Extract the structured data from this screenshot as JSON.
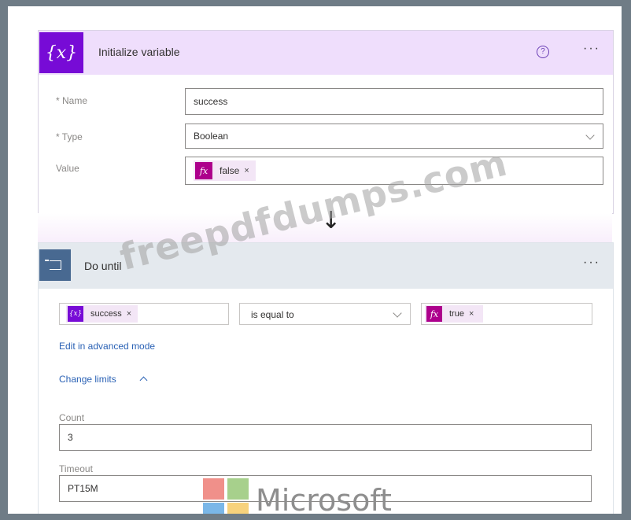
{
  "init_variable": {
    "title": "Initialize variable",
    "name_label": "* Name",
    "name_value": "success",
    "type_label": "* Type",
    "type_value": "Boolean",
    "value_label": "Value",
    "value_token": {
      "label": "false",
      "icon": "fx-icon"
    }
  },
  "do_until": {
    "title": "Do until",
    "condition": {
      "left_token": {
        "label": "success",
        "icon": "variable-icon"
      },
      "operator": "is equal to",
      "right_token": {
        "label": "true",
        "icon": "fx-icon"
      }
    },
    "advanced_link": "Edit in advanced mode",
    "change_limits_link": "Change limits",
    "count_label": "Count",
    "count_value": "3",
    "timeout_label": "Timeout",
    "timeout_value": "PT15M"
  },
  "watermark": "freepdfdumps.com",
  "brand": {
    "text": "Microsoft"
  },
  "glyphs": {
    "close": "×",
    "more": "···",
    "help": "?",
    "var_icon": "{x}",
    "fx": "fx",
    "arrow": "↓"
  },
  "colors": {
    "variable_purple": "#770bd6",
    "expression_magenta": "#ad008c",
    "loop_blue": "#486991",
    "link_blue": "#2b62b5"
  }
}
